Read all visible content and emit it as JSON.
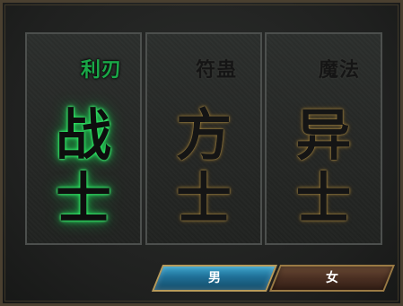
{
  "classes": [
    {
      "id": "warrior",
      "subtitle": "利刃",
      "name_top": "战",
      "name_bottom": "士",
      "selected": true
    },
    {
      "id": "taoist",
      "subtitle": "符蛊",
      "name_top": "方",
      "name_bottom": "士",
      "selected": false
    },
    {
      "id": "mage",
      "subtitle": "魔法",
      "name_top": "异",
      "name_bottom": "士",
      "selected": false
    }
  ],
  "gender": {
    "male_label": "男",
    "female_label": "女",
    "selected": "male"
  },
  "colors": {
    "selected_glow": "#22d85a",
    "subtitle_selected": "#1aa848",
    "male_button": "#2a86b0",
    "female_button": "#4a2f22",
    "gold_trim": "#b79b5c"
  }
}
